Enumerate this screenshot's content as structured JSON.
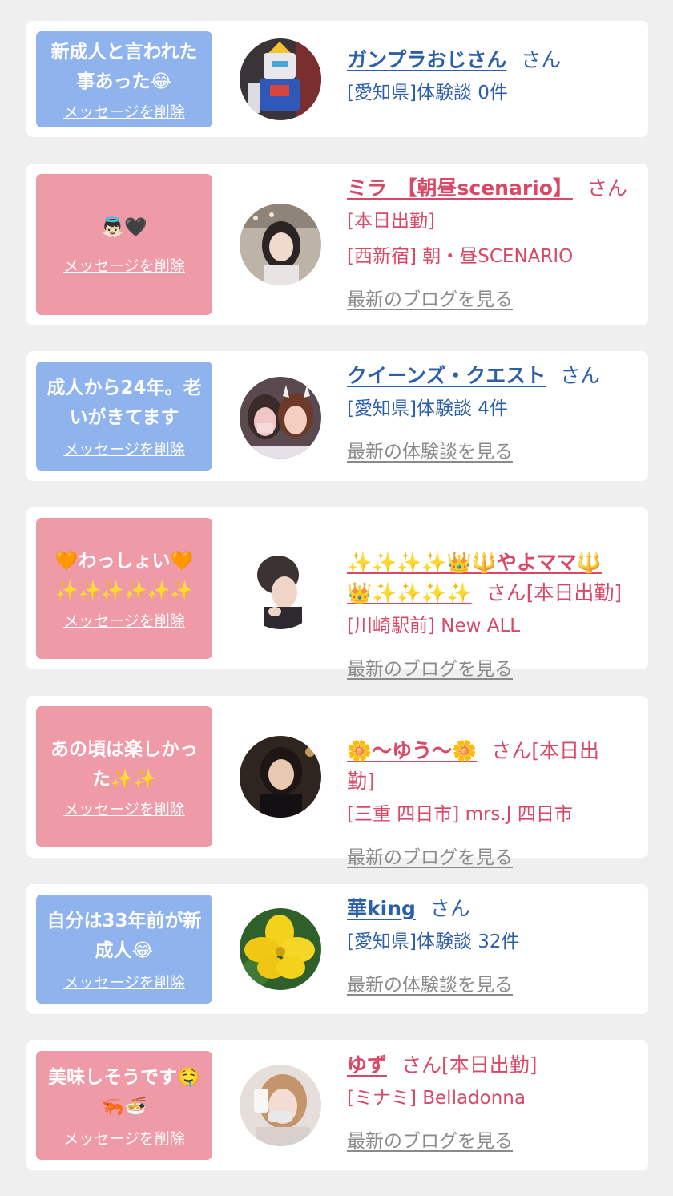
{
  "delete_label": "メッセージを削除",
  "colors": {
    "blue_bubble": "#8fb3ec",
    "pink_bubble": "#ee9aa7",
    "blue_text": "#2d5fa8",
    "pink_text": "#d94866",
    "link_gray": "#8a8a8a"
  },
  "cards": [
    {
      "message": "新成人と言われた\n事あった😂",
      "name": "ガンプラおじさん",
      "honorific": "さん",
      "lines": [
        "[愛知県]体験談 0件"
      ],
      "link": ""
    },
    {
      "message": "👼🏻🖤",
      "name": "ミラ　【朝昼scenario】",
      "honorific": "さん",
      "lines": [
        "[本日出勤]",
        "[西新宿] 朝・昼SCENARIO"
      ],
      "link": "最新のブログを見る"
    },
    {
      "message": "成人から24年。老\nいがきてます",
      "name": "クイーンズ・クエスト",
      "honorific": "さん",
      "lines": [
        "[愛知県]体験談 4件"
      ],
      "link": "最新の体験談を見る"
    },
    {
      "message": "🧡わっしょい🧡\n✨✨✨✨✨✨",
      "name": "✨✨✨✨👑🔱やよママ🔱\n👑✨✨✨✨",
      "honorific": "さん[本日出勤]",
      "lines": [
        "[川崎駅前] New ALL"
      ],
      "link": "最新のブログを見る"
    },
    {
      "message": "あの頃は楽しかっ\nた✨✨",
      "name": "🌼〜ゆう〜🌼",
      "honorific": "さん[本日出\n勤]",
      "lines": [
        "[三重 四日市] mrs.J 四日市"
      ],
      "link": "最新のブログを見る"
    },
    {
      "message": "自分は33年前が新\n成人😂",
      "name": "華king",
      "honorific": "さん",
      "lines": [
        "[愛知県]体験談 32件"
      ],
      "link": "最新の体験談を見る"
    },
    {
      "message": "美味しそうです🤤\n🦐🍜",
      "name": "ゆず",
      "honorific": "さん[本日出勤]",
      "lines": [
        "[ミナミ] Belladonna"
      ],
      "link": "最新のブログを見る"
    }
  ]
}
